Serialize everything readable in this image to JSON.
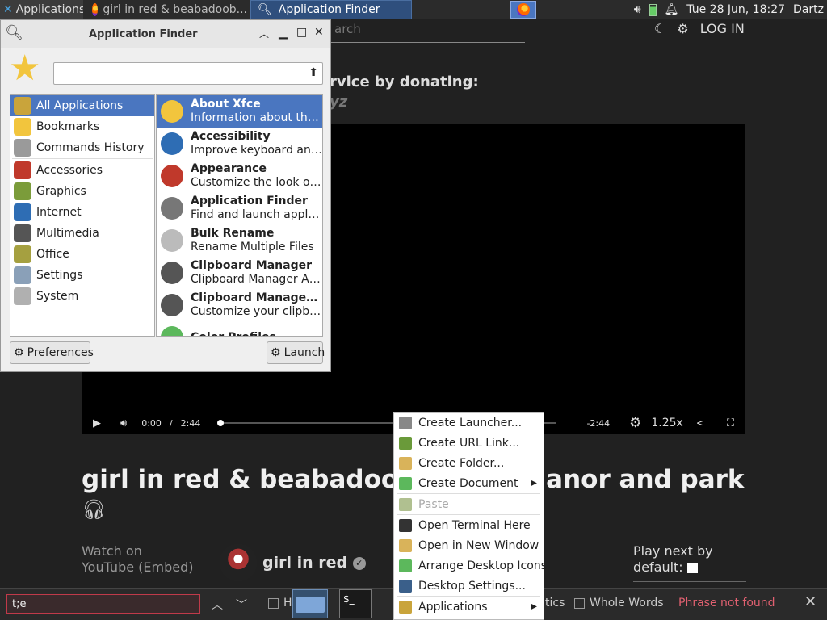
{
  "panel": {
    "applications_label": "Applications",
    "task1_label": "girl in red & beabadoob...",
    "task2_label": "Application Finder",
    "clock": "Tue 28 Jun, 18:27",
    "user": "Dartz"
  },
  "webpage": {
    "search_placeholder": "arch",
    "login": "LOG IN",
    "donate_line": "rvice by donating:",
    "donate_line2": "yz",
    "time_current": "0:00",
    "time_sep": "/",
    "time_total": "2:44",
    "time_remaining": "-2:44",
    "speed": "1.25x",
    "progress_fraction": 0.0,
    "title": "girl in red & beabadoo",
    "title_end": "anor and park",
    "watch_on": "Watch on",
    "youtube": "YouTube",
    "embed": "(Embed)",
    "artist": "girl in red",
    "play_next": "Play next by",
    "default_label": "default:"
  },
  "findbar": {
    "query": "t;e",
    "highlight_partial": "H",
    "diacritics_partial": "tics",
    "whole_words": "Whole Words",
    "status": "Phrase not found"
  },
  "finder": {
    "title": "Application Finder",
    "search_value": "",
    "categories": [
      {
        "label": "All Applications",
        "icon": "all-apps-icon",
        "color": "#c9a43b"
      },
      {
        "label": "Bookmarks",
        "icon": "star-icon",
        "color": "#f2c53d"
      },
      {
        "label": "Commands History",
        "icon": "gears-icon",
        "color": "#9a9a9a"
      },
      {
        "label": "Accessories",
        "icon": "accessories-icon",
        "color": "#c0392b"
      },
      {
        "label": "Graphics",
        "icon": "graphics-icon",
        "color": "#7b9c3a"
      },
      {
        "label": "Internet",
        "icon": "globe-icon",
        "color": "#2e6db4"
      },
      {
        "label": "Multimedia",
        "icon": "multimedia-icon",
        "color": "#555555"
      },
      {
        "label": "Office",
        "icon": "office-icon",
        "color": "#a5a040"
      },
      {
        "label": "Settings",
        "icon": "settings-icon",
        "color": "#8aa0b8"
      },
      {
        "label": "System",
        "icon": "system-icon",
        "color": "#b0b0b0"
      }
    ],
    "apps": [
      {
        "name": "About Xfce",
        "desc": "Information about the Xfce Desktop Environment",
        "icon": "star-icon",
        "color": "#f2c53d"
      },
      {
        "name": "Accessibility",
        "desc": "Improve keyboard and mouse accessibility",
        "icon": "accessibility-icon",
        "color": "#2e6db4"
      },
      {
        "name": "Appearance",
        "desc": "Customize the look of your desktop",
        "icon": "palette-icon",
        "color": "#c0392b"
      },
      {
        "name": "Application Finder",
        "desc": "Find and launch applications",
        "icon": "magnifier-icon",
        "color": "#777777"
      },
      {
        "name": "Bulk Rename",
        "desc": "Rename Multiple Files",
        "icon": "folder-icon",
        "color": "#bbbbbb"
      },
      {
        "name": "Clipboard Manager",
        "desc": "Clipboard Manager Autostart File",
        "icon": "clipboard-icon",
        "color": "#555555"
      },
      {
        "name": "Clipboard Manager Settings",
        "desc": "Customize your clipboard",
        "icon": "clipboard-icon",
        "color": "#555555"
      },
      {
        "name": "Color Profiles",
        "desc": "",
        "icon": "color-icon",
        "color": "#5cb85c"
      }
    ],
    "preferences_label": "Preferences",
    "launch_label": "Launch"
  },
  "context_menu": {
    "items": [
      {
        "label": "Create Launcher...",
        "icon": "launcher-icon",
        "color": "#888888",
        "disabled": false,
        "submenu": false
      },
      {
        "label": "Create URL Link...",
        "icon": "link-icon",
        "color": "#6a9a3a",
        "disabled": false,
        "submenu": false
      },
      {
        "label": "Create Folder...",
        "icon": "folder-icon",
        "color": "#d9b35a",
        "disabled": false,
        "submenu": false
      },
      {
        "label": "Create Document",
        "icon": "document-icon",
        "color": "#5cb85c",
        "disabled": false,
        "submenu": true
      },
      {
        "label": "Paste",
        "icon": "paste-icon",
        "color": "#b0c090",
        "disabled": true,
        "submenu": false
      },
      {
        "label": "Open Terminal Here",
        "icon": "terminal-icon",
        "color": "#333333",
        "disabled": false,
        "submenu": false
      },
      {
        "label": "Open in New Window",
        "icon": "folder-icon",
        "color": "#d9b35a",
        "disabled": false,
        "submenu": false
      },
      {
        "label": "Arrange Desktop Icons",
        "icon": "arrange-icon",
        "color": "#5cb85c",
        "disabled": false,
        "submenu": false
      },
      {
        "label": "Desktop Settings...",
        "icon": "desktop-icon",
        "color": "#3a5f8a",
        "disabled": false,
        "submenu": false
      },
      {
        "label": "Applications",
        "icon": "applications-icon",
        "color": "#c9a43b",
        "disabled": false,
        "submenu": true
      }
    ]
  }
}
